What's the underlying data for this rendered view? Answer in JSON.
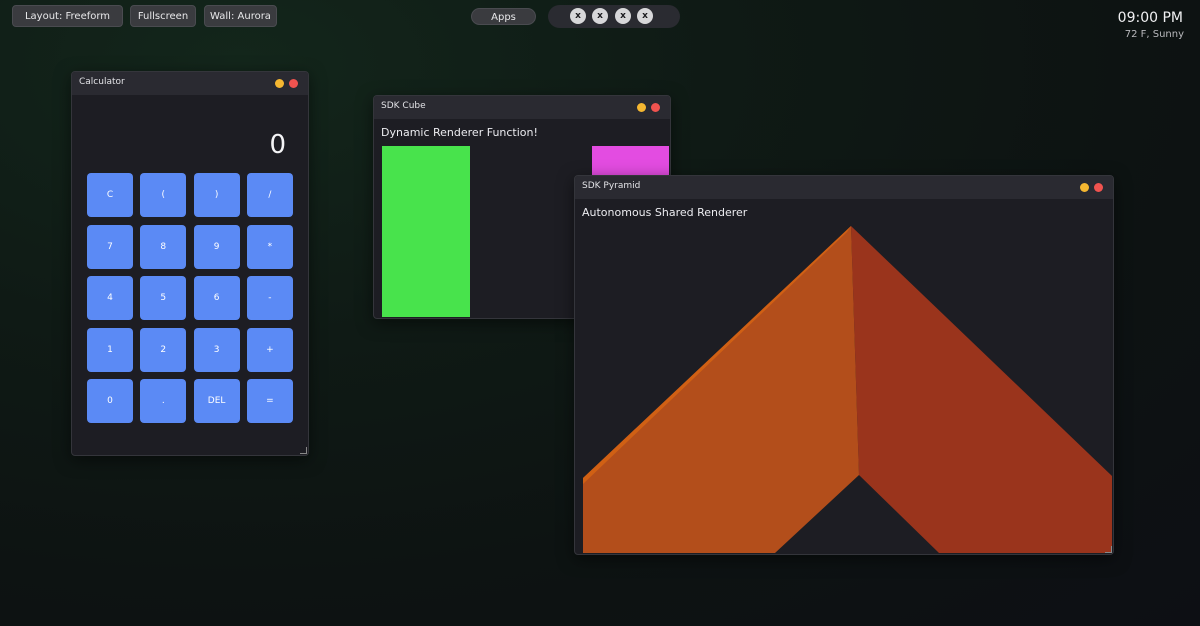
{
  "topbar": {
    "layout_label": "Layout: Freeform",
    "fullscreen_label": "Fullscreen",
    "wall_label": "Wall: Aurora",
    "apps_label": "Apps",
    "dock_items": [
      "x",
      "x",
      "x",
      "x"
    ],
    "clock": "09:00 PM",
    "weather": "72 F, Sunny"
  },
  "calculator": {
    "title": "Calculator",
    "display": "0",
    "keys": [
      "C",
      "(",
      ")",
      "/",
      "7",
      "8",
      "9",
      "*",
      "4",
      "5",
      "6",
      "-",
      "1",
      "2",
      "3",
      "+",
      "0",
      ".",
      "DEL",
      "="
    ]
  },
  "cube": {
    "title": "SDK Cube",
    "heading": "Dynamic Renderer Function!"
  },
  "pyramid": {
    "title": "SDK Pyramid",
    "heading": "Autonomous Shared Renderer"
  },
  "colors": {
    "minimize_dot": "#f5b731",
    "close_dot": "#f0534f",
    "calc_key": "#5b8af5",
    "cube_green": "#48e34c",
    "cube_magenta": "#e34ce1",
    "pyramid_left_face": "#b34e1b",
    "pyramid_right_face": "#9a341c",
    "pyramid_edge": "#d06014"
  }
}
